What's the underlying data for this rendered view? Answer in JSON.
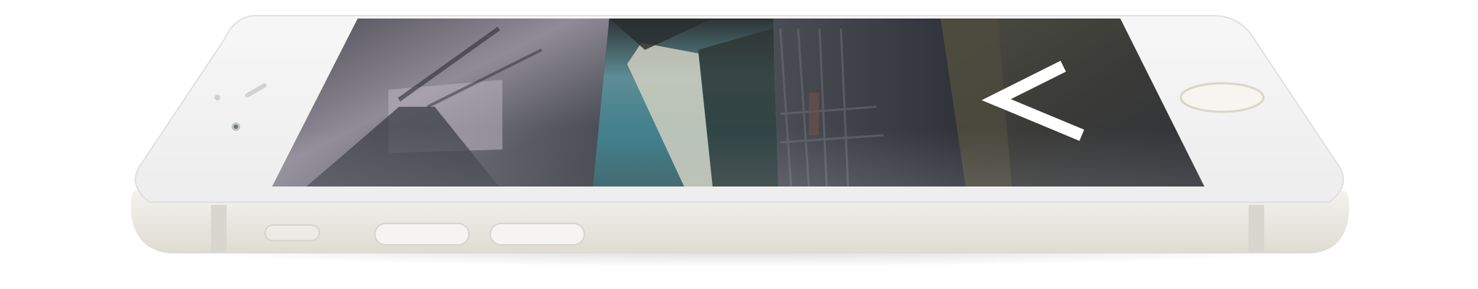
{
  "device": {
    "name": "phone",
    "body_color": "#f2f2f0",
    "side_color": "#e6e6e0",
    "screen_tint": "#3a3d44"
  },
  "screen": {
    "panels": [
      {
        "name": "panel-city-bridge",
        "palette": [
          "#50505a",
          "#a7a2ad",
          "#3f4047",
          "#746f79"
        ]
      },
      {
        "name": "panel-beach-aerial",
        "palette": [
          "#2f5f66",
          "#5f9aa3",
          "#d8d4c6",
          "#2b3433"
        ]
      },
      {
        "name": "panel-bridge-cables",
        "palette": [
          "#3c3f46",
          "#6f707a",
          "#5a4c4a",
          "#2e3036"
        ]
      },
      {
        "name": "panel-hillside",
        "palette": [
          "#3a3b36",
          "#5a5a48",
          "#2f3037",
          "#6a6651"
        ]
      }
    ],
    "back_icon": "chevron-left-icon"
  }
}
